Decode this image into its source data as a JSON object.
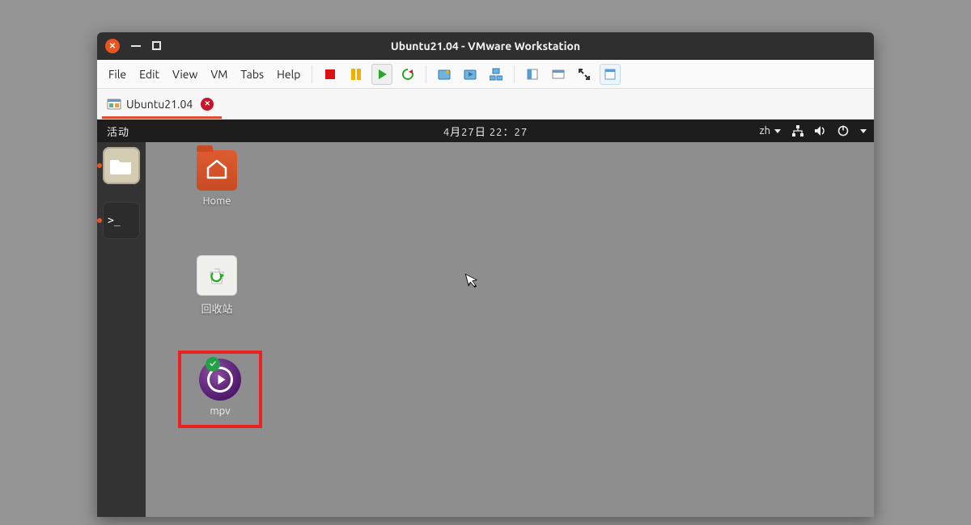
{
  "window": {
    "title": "Ubuntu21.04 - VMware Workstation"
  },
  "menu": {
    "file": "File",
    "edit": "Edit",
    "view": "View",
    "vm": "VM",
    "tabs": "Tabs",
    "help": "Help"
  },
  "tab": {
    "label": "Ubuntu21.04"
  },
  "gnome": {
    "activities": "活动",
    "clock": "4月27日  22：27",
    "ime": "zh"
  },
  "desktop": {
    "home_label": "Home",
    "trash_label": "回收站",
    "mpv_label": "mpv"
  }
}
